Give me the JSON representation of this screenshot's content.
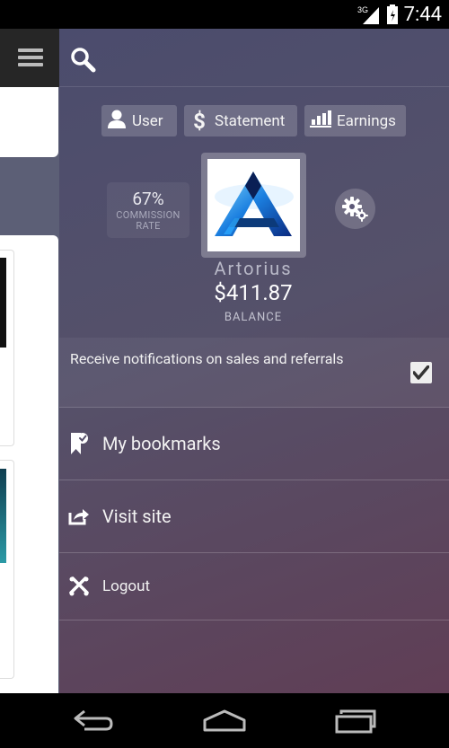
{
  "status_bar": {
    "network": "3G",
    "time": "7:44"
  },
  "drawer": {
    "tabs": [
      {
        "label": "User",
        "icon": "user-icon"
      },
      {
        "label": "Statement",
        "icon": "dollar-icon"
      },
      {
        "label": "Earnings",
        "icon": "bar-chart-icon"
      }
    ],
    "commission": {
      "value": "67%",
      "label_line1": "COMMISSION",
      "label_line2": "RATE"
    },
    "profile": {
      "username": "Artorius",
      "balance": "$411.87",
      "balance_label": "BALANCE"
    },
    "notifications": {
      "label": "Receive notifications on sales and referrals",
      "checked": true
    },
    "menu": [
      {
        "label": "My bookmarks",
        "icon": "bookmark-icon"
      },
      {
        "label": "Visit site",
        "icon": "share-icon"
      },
      {
        "label": "Logout",
        "icon": "logout-icon"
      }
    ]
  },
  "colors": {
    "drawer_top": "#4b4c6d",
    "drawer_bottom": "#603e55",
    "toolbar": "#262626"
  }
}
